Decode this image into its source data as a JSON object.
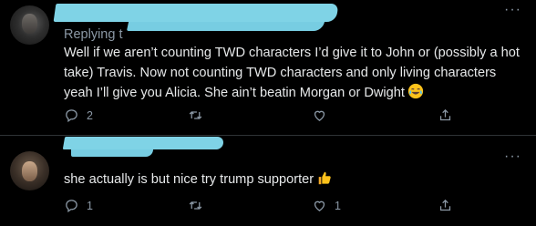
{
  "tweet1": {
    "replying_prefix": "Replying t",
    "text": "Well if we aren’t counting TWD characters I’d give it to John or (possibly a hot take) Travis. Now not counting TWD characters and only living characters yeah I’ll give you Alicia. She ain’t beatin Morgan or Dwight",
    "emoji": "laughing-crying-emoji",
    "reply_count": "2",
    "retweet_count": "",
    "like_count": ""
  },
  "tweet2": {
    "text": "she actually is but nice try trump supporter",
    "emoji": "thumbs-up-emoji",
    "reply_count": "1",
    "retweet_count": "",
    "like_count": "1"
  },
  "icons": [
    "reply-icon",
    "retweet-icon",
    "like-icon",
    "share-icon",
    "more-icon"
  ],
  "colors": {
    "background": "#000000",
    "text": "#e7e9ea",
    "muted": "#8b98a5",
    "redaction": "#7fd3e6"
  }
}
